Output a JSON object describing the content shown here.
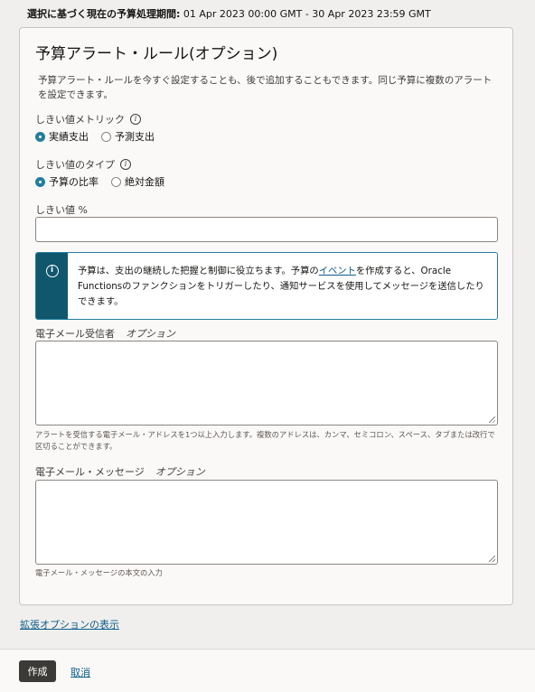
{
  "header": {
    "period_label": "選択に基づく現在の予算処理期間:",
    "period_value": "01 Apr 2023 00:00 GMT - 30 Apr 2023 23:59 GMT"
  },
  "panel": {
    "title": "予算アラート・ルール(オプション)",
    "description": "予算アラート・ルールを今すぐ設定することも、後で追加することもできます。同じ予算に複数のアラートを設定できます。",
    "threshold_metric": {
      "label": "しきい値メトリック",
      "options": [
        {
          "label": "実績支出",
          "selected": true
        },
        {
          "label": "予測支出",
          "selected": false
        }
      ]
    },
    "threshold_type": {
      "label": "しきい値のタイプ",
      "options": [
        {
          "label": "予算の比率",
          "selected": true
        },
        {
          "label": "絶対金額",
          "selected": false
        }
      ]
    },
    "threshold_value": {
      "label": "しきい値 %",
      "value": ""
    },
    "info_box": {
      "text_before": "予算は、支出の継続した把握と制御に役立ちます。予算の",
      "link": "イベント",
      "text_after": "を作成すると、Oracle Functionsのファンクションをトリガーしたり、通知サービスを使用してメッセージを送信したりできます。"
    },
    "email_recipients": {
      "label": "電子メール受信者",
      "optional": "オプション",
      "value": "",
      "help": "アラートを受信する電子メール・アドレスを1つ以上入力します。複数のアドレスは、カンマ、セミコロン、スペース、タブまたは改行で区切ることができます。"
    },
    "email_message": {
      "label": "電子メール・メッセージ",
      "optional": "オプション",
      "value": "",
      "help": "電子メール・メッセージの本文の入力"
    }
  },
  "expand_link": "拡張オプションの表示",
  "footer": {
    "create_label": "作成",
    "cancel_label": "取消"
  },
  "icons": {
    "info": "info-icon",
    "info_circle": "info-circle-icon"
  },
  "colors": {
    "accent": "#227e9e",
    "info_bar": "#10576d",
    "link": "#0a5c8a",
    "primary_button": "#3c3a37"
  }
}
